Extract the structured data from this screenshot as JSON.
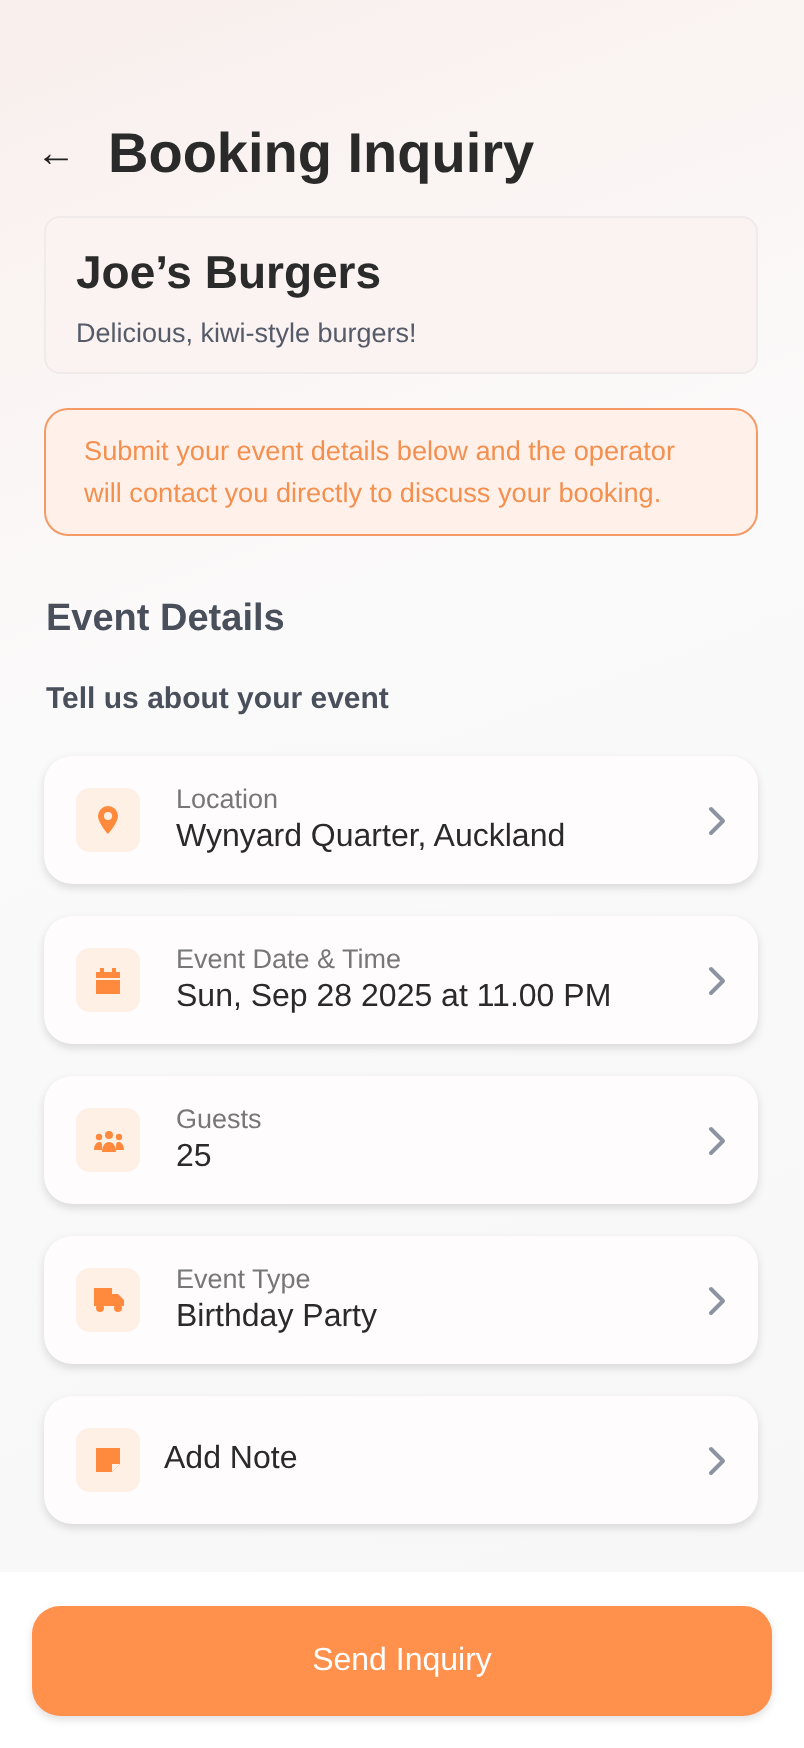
{
  "header": {
    "back": "←",
    "title": "Booking Inquiry"
  },
  "vendor": {
    "name": "Joe’s Burgers",
    "tagline": "Delicious, kiwi-style burgers!"
  },
  "notice": "Submit your event details below and the operator will contact you directly to discuss your booking.",
  "section": {
    "title": "Event Details",
    "subtitle": "Tell us about your event"
  },
  "items": [
    {
      "kind": "field",
      "label": "Location",
      "value": "Wynyard Quarter, Auckland"
    },
    {
      "kind": "field",
      "label": "Event Date & Time",
      "value": "Sun, Sep 28 2025 at 11.00 PM"
    },
    {
      "kind": "field",
      "label": "Guests",
      "value": "25"
    },
    {
      "kind": "field",
      "label": "Event Type",
      "value": "Birthday Party"
    },
    {
      "kind": "action",
      "label": "Add Note"
    }
  ],
  "button": "Send Inquiry"
}
